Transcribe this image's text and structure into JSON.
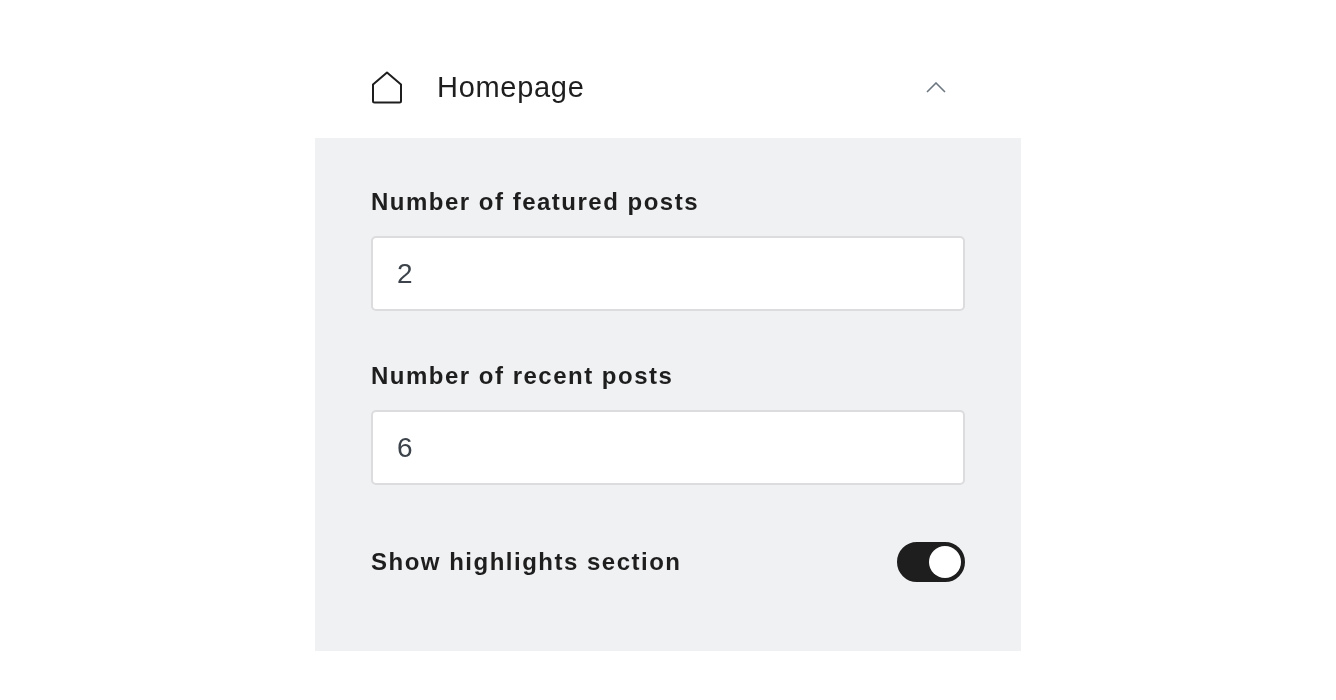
{
  "section": {
    "title": "Homepage",
    "expanded": true
  },
  "fields": [
    {
      "kind": "number",
      "label": "Number of featured posts",
      "value": "2"
    },
    {
      "kind": "number",
      "label": "Number of recent posts",
      "value": "6"
    },
    {
      "kind": "toggle",
      "label": "Show highlights section",
      "on": true
    }
  ]
}
